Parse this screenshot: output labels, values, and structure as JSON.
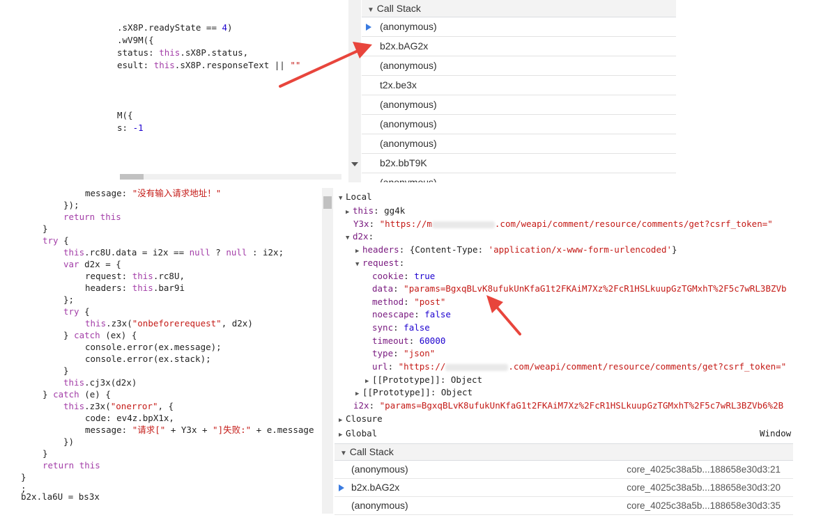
{
  "top_code": {
    "lines": [
      [
        ".sX8P.readyState == ",
        "4",
        ")"
      ],
      [
        ".wV9M({"
      ],
      [
        "status: ",
        "this",
        ".sX8P.status,"
      ],
      [
        "esult: ",
        "this",
        ".sX8P.responseText || ",
        "\"\""
      ],
      [
        "M({"
      ],
      [
        "s: ",
        "-1"
      ]
    ]
  },
  "top_callstack": {
    "header": "Call Stack",
    "items": [
      "(anonymous)",
      "b2x.bAG2x",
      "(anonymous)",
      "t2x.be3x",
      "(anonymous)",
      "(anonymous)",
      "(anonymous)",
      "b2x.bbT9K",
      "(anonymous)"
    ]
  },
  "bottom_code": {
    "message1_key": "message: ",
    "message1_val": "\"没有输入请求地址！\"",
    "close1": "});",
    "return1_kw": "return",
    "return1_this": "this",
    "close2": "}",
    "try_kw": "try",
    "brace_open": " {",
    "this_kw": "this",
    "rc8u_assign": ".rc8U.data = i2x == ",
    "null1": "null",
    "ternary": " ? ",
    "null2": "null",
    "ternary_end": " : i2x;",
    "var_kw": "var",
    "d2x_decl": " d2x = {",
    "request_key": "request: ",
    "request_val": ".rc8U,",
    "headers_key": "headers: ",
    "headers_val": ".bar9i",
    "close_obj": "};",
    "try2_kw": "try",
    "z3x_call": ".z3x(",
    "z3x_str": "\"onbeforerequest\"",
    "z3x_end": ", d2x)",
    "catch_close": "} ",
    "catch_kw": "catch",
    "catch_ex": " (ex) {",
    "console1": "console.error(ex.message);",
    "console2": "console.error(ex.stack);",
    "close3": "}",
    "cj3x_call": ".cj3x(d2x)",
    "catch2_close": "} ",
    "catch2_kw": "catch",
    "catch2_e": " (e) {",
    "onerror_call": ".z3x(",
    "onerror_str": "\"onerror\"",
    "onerror_end": ", {",
    "code_line": "code: ev4z.bpX1x,",
    "message2_key": "message: ",
    "message2_str1": "\"请求[\"",
    "message2_mid": " + Y3x + ",
    "message2_str2": "\"]失败:\"",
    "message2_end": " + e.message",
    "close4": "})",
    "close5": "}",
    "return2_kw": "return",
    "return2_this": "this",
    "close6": "}",
    "semicolon": ";",
    "last_line": "b2x.la6U = bs3x"
  },
  "scope": {
    "local_label": "Local",
    "this_key": "this",
    "this_val": ": gg4k",
    "y3x_key": "Y3x",
    "y3x_val_pre": "\"https://m",
    "y3x_val_post": ".com/weapi/comment/resource/comments/get?csrf_token=\"",
    "d2x_key": "d2x",
    "headers_key": "headers",
    "headers_val_pre": ": {Content-Type: ",
    "headers_val_str": "'application/x-www-form-urlencoded'",
    "headers_val_post": "}",
    "request_key": "request",
    "cookie_key": "cookie",
    "cookie_val": "true",
    "data_key": "data",
    "data_val": "\"params=BgxqBLvK8ufukUnKfaG1t2FKAiM7Xz%2FcR1HSLkuupGzTGMxhT%2F5c7wRL3BZVb",
    "method_key": "method",
    "method_val": "\"post\"",
    "noescape_key": "noescape",
    "noescape_val": "false",
    "sync_key": "sync",
    "sync_val": "false",
    "timeout_key": "timeout",
    "timeout_val": "60000",
    "type_key": "type",
    "type_val": "\"json\"",
    "url_key": "url",
    "url_val_pre": "\"https://",
    "url_val_post": ".com/weapi/comment/resource/comments/get?csrf_token=\"",
    "proto_inner": "[[Prototype]]",
    "proto_inner_val": ": Object",
    "proto_outer": "[[Prototype]]",
    "proto_outer_val": ": Object",
    "i2x_key": "i2x",
    "i2x_val": "\"params=BgxqBLvK8ufukUnKfaG1t2FKAiM7Xz%2FcR1HSLkuupGzTGMxhT%2F5c7wRL3BZVb6%2B",
    "closure_label": "Closure",
    "global_label": "Global",
    "global_val": "Window"
  },
  "bottom_callstack": {
    "header": "Call Stack",
    "items": [
      {
        "name": "(anonymous)",
        "loc": "core_4025c38a5b...188658e30d3:21"
      },
      {
        "name": "b2x.bAG2x",
        "loc": "core_4025c38a5b...188658e30d3:20"
      },
      {
        "name": "(anonymous)",
        "loc": "core_4025c38a5b...188658e30d3:35"
      }
    ]
  },
  "colors": {
    "annotation_arrow": "#e8453c",
    "current_frame_marker": "#3a7be0",
    "keyword": "#a33ea8",
    "string": "#c41a16",
    "number": "#1c00cf"
  }
}
